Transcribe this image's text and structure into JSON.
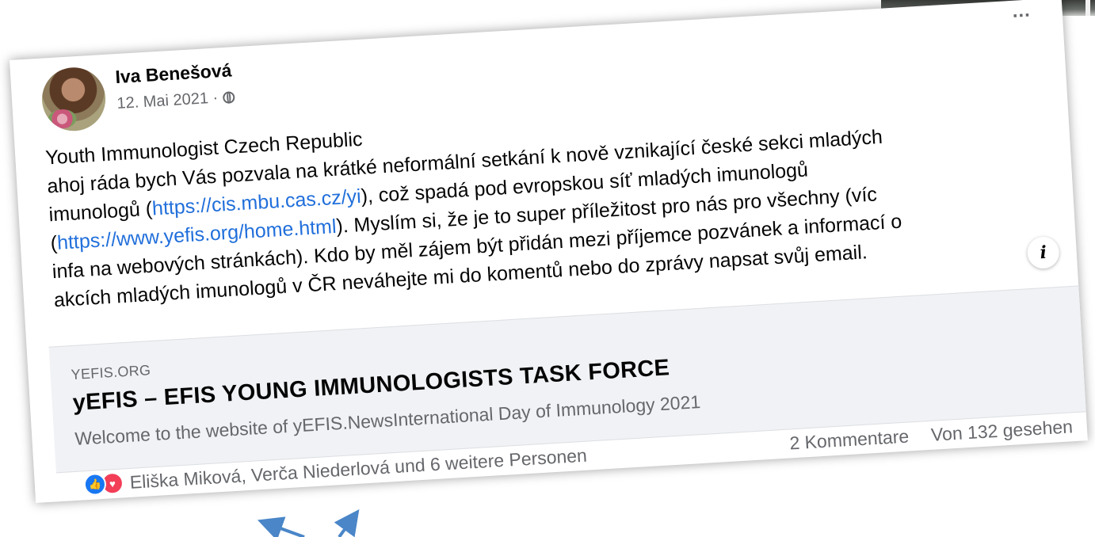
{
  "post": {
    "author": "Iva Benešová",
    "date": "12. Mai 2021 ·",
    "more_label": "...",
    "body": {
      "line1": "Youth Immunologist Czech Republic",
      "line2": "ahoj ráda bych Vás pozvala na krátké neformální setkání k nově vznikající české sekci mladých",
      "line3_pre": "imunologů (",
      "link1": "https://cis.mbu.cas.cz/yi",
      "line3_post": "), což spadá pod evropskou síť mladých imunologů",
      "line4_pre": "(",
      "link2": "https://www.yefis.org/home.html",
      "line4_post": "). Myslím si, že je to super příležitost pro nás pro všechny (víc",
      "line5": "infa na webových stránkách). Kdo by měl zájem být přidán mezi příjemce pozvánek a informací o",
      "line6": "akcích mladých imunologů v ČR neváhejte mi do komentů nebo do zprávy napsat svůj email."
    },
    "info_label": "i"
  },
  "link_preview": {
    "domain": "YEFIS.ORG",
    "title": "yEFIS – EFIS YOUNG IMMUNOLOGISTS TASK FORCE",
    "description": "Welcome to the website of yEFIS.NewsInternational Day of Immunology 2021"
  },
  "footer": {
    "reactions_text": "Eliška Miková, Verča Niederlová und 6 weitere Personen",
    "comments": "2 Kommentare",
    "views": "Von 132 gesehen"
  },
  "colors": {
    "link": "#216fdb",
    "like": "#1877f2",
    "love": "#f33e58",
    "annotation_arrow": "#4a86c8"
  },
  "icons": [
    "globe-icon",
    "like-icon",
    "love-icon",
    "info-icon",
    "more-icon"
  ]
}
